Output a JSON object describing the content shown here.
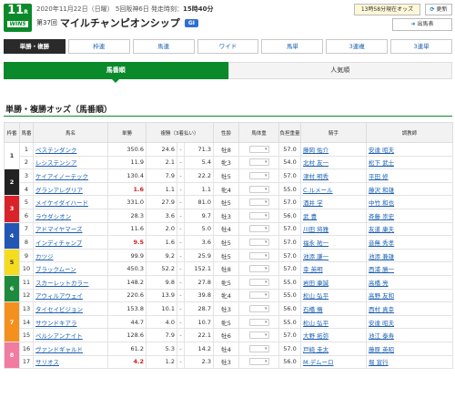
{
  "race": {
    "number": "11",
    "number_unit": "R",
    "win5_label": "WIN5",
    "meta_date": "2020年11月22日（日曜）",
    "meta_kai": "5回阪神6日",
    "meta_start_label": "発走時刻：",
    "meta_start_time": "15時40分",
    "kai": "第37回",
    "name": "マイルチャンピオンシップ",
    "grade": "GI"
  },
  "buttons": {
    "odds_time": "13時58分現在オッズ",
    "refresh_icon": "refresh-icon",
    "refresh_label": "更新",
    "shutsuba_icon": "circle-arrow-icon",
    "shutsuba_label": "出馬表"
  },
  "bet_tabs": [
    {
      "label": "単勝・複勝",
      "active": true
    },
    {
      "label": "枠連",
      "active": false
    },
    {
      "label": "馬連",
      "active": false
    },
    {
      "label": "ワイド",
      "active": false
    },
    {
      "label": "馬単",
      "active": false
    },
    {
      "label": "3連複",
      "active": false
    },
    {
      "label": "3連単",
      "active": false
    }
  ],
  "order_tabs": [
    {
      "label": "馬番順",
      "active": true
    },
    {
      "label": "人気順",
      "active": false
    }
  ],
  "section_title": "単勝・複勝オッズ（馬番順）",
  "table": {
    "headers": [
      "枠番",
      "馬番",
      "馬名",
      "単勝",
      "複勝（3着払い）",
      "性齢",
      "馬体重",
      "負担重量",
      "騎手",
      "調教師"
    ],
    "rows": [
      {
        "waku": "1",
        "num": "1",
        "horse": "ペルシアンナイト",
        "tan": "",
        "fmin": "",
        "fmax": "",
        "sex": "",
        "weight": "",
        "wt": "",
        "jockey": "",
        "trainer": ""
      }
    ]
  },
  "waku_colors": {
    "1": "#ffffff",
    "2": "#222222",
    "3": "#d8232a",
    "4": "#2257b3",
    "5": "#f5dc1e",
    "6": "#1e8a3c",
    "7": "#f5901e",
    "8": "#f27ba2"
  }
}
